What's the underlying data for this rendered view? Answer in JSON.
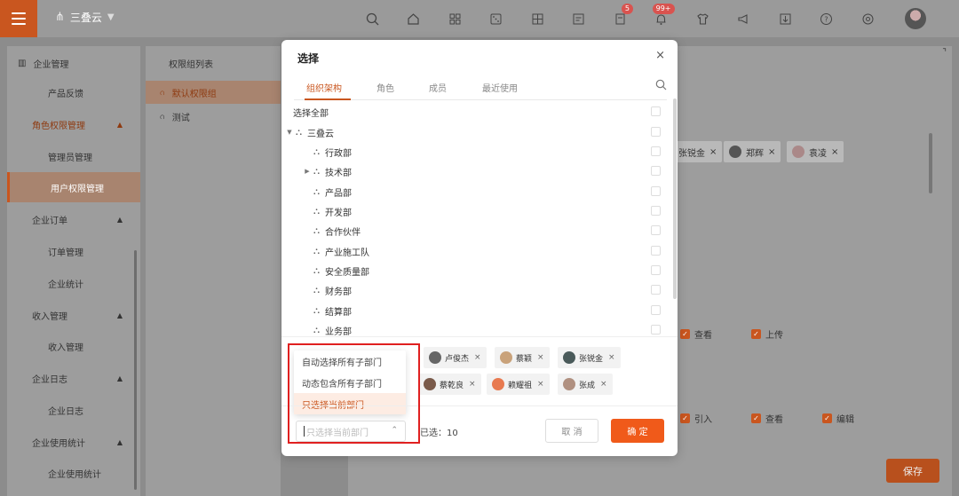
{
  "topbar": {
    "company": "三叠云",
    "badge_tasks": "5",
    "badge_notify": "99+"
  },
  "sidebar": {
    "header": "企业管理",
    "items": [
      {
        "label": "产品反馈",
        "type": "sub"
      },
      {
        "label": "角色权限管理",
        "type": "group",
        "arrow": "▲"
      },
      {
        "label": "管理员管理",
        "type": "sub"
      },
      {
        "label": "用户权限管理",
        "type": "sub"
      },
      {
        "label": "企业订单",
        "type": "group",
        "arrow": "▲"
      },
      {
        "label": "订单管理",
        "type": "sub"
      },
      {
        "label": "企业统计",
        "type": "sub"
      },
      {
        "label": "收入管理",
        "type": "group",
        "arrow": "▲"
      },
      {
        "label": "收入管理",
        "type": "sub"
      },
      {
        "label": "企业日志",
        "type": "group",
        "arrow": "▲"
      },
      {
        "label": "企业日志",
        "type": "sub"
      },
      {
        "label": "企业使用统计",
        "type": "group",
        "arrow": "▲"
      },
      {
        "label": "企业使用统计",
        "type": "sub"
      }
    ]
  },
  "perm_panel": {
    "title": "权限组列表",
    "items": [
      "默认权限组",
      "测试"
    ]
  },
  "content": {
    "chips": [
      "张锐金",
      "郑辉",
      "袁凌"
    ],
    "row1": [
      "查看",
      "上传"
    ],
    "row2": [
      "引入",
      "查看",
      "编辑"
    ],
    "save": "保存"
  },
  "modal": {
    "title": "选择",
    "close": "×",
    "tabs": [
      "组织架构",
      "角色",
      "成员",
      "最近使用"
    ],
    "select_all": "选择全部",
    "root": "三叠云",
    "departments": [
      {
        "name": "行政部",
        "expandable": false
      },
      {
        "name": "技术部",
        "expandable": true
      },
      {
        "name": "产品部",
        "expandable": false
      },
      {
        "name": "开发部",
        "expandable": false
      },
      {
        "name": "合作伙伴",
        "expandable": false
      },
      {
        "name": "产业施工队",
        "expandable": false
      },
      {
        "name": "安全质量部",
        "expandable": false
      },
      {
        "name": "财务部",
        "expandable": false
      },
      {
        "name": "结算部",
        "expandable": false
      },
      {
        "name": "业务部",
        "expandable": false
      }
    ],
    "selected_chips_row1": [
      "卢俊杰",
      "蔡颖",
      "张锐金"
    ],
    "selected_chips_row2": [
      "蔡乾良",
      "赖耀祖",
      "张成"
    ],
    "dropdown_options": [
      "自动选择所有子部门",
      "动态包含所有子部门",
      "只选择当前部门"
    ],
    "select_placeholder": "只选择当前部门",
    "selected_count": "已选：10",
    "cancel": "取 消",
    "ok": "确 定"
  },
  "colors": {
    "accent": "#f05a1a",
    "highlight": "#e02020"
  }
}
